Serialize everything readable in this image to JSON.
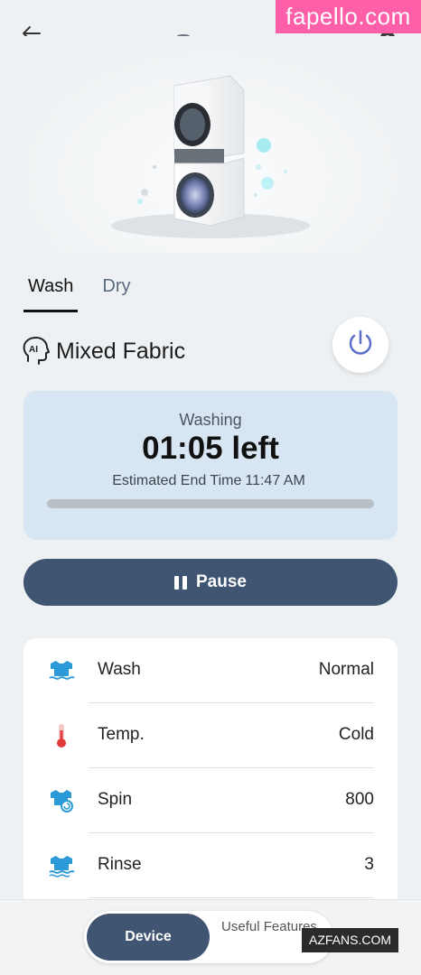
{
  "header": {
    "back_icon": "back-arrow-icon",
    "settings_icon": "gear-icon"
  },
  "watermarks": {
    "top": "fapello.com",
    "bottom": "AZFANS.COM"
  },
  "hero": {
    "image": "stacked-washer-dryer"
  },
  "tabs": [
    {
      "label": "Wash",
      "active": true
    },
    {
      "label": "Dry",
      "active": false
    }
  ],
  "program": {
    "icon": "ai-head-icon",
    "name": "Mixed Fabric"
  },
  "power_icon": "power-icon",
  "status": {
    "label": "Washing",
    "remaining": "01:05 left",
    "end_time_label": "Estimated End Time",
    "end_time_value": "11:47 AM",
    "progress": 0
  },
  "controls": {
    "pause_label": "Pause",
    "pause_icon": "pause-icon"
  },
  "settings": [
    {
      "icon": "wash-shirt-icon",
      "label": "Wash",
      "value": "Normal"
    },
    {
      "icon": "thermometer-icon",
      "label": "Temp.",
      "value": "Cold"
    },
    {
      "icon": "spin-shirt-icon",
      "label": "Spin",
      "value": "800"
    },
    {
      "icon": "rinse-shirt-icon",
      "label": "Rinse",
      "value": "3"
    }
  ],
  "bottom_nav": {
    "device_label": "Device",
    "features_label": "Useful Features"
  },
  "colors": {
    "accent": "#3f5571",
    "status_card": "#d7e6f2",
    "background": "#eef1f3",
    "icon_blue": "#2b9ad6",
    "power_ring": "#5b6fc9"
  }
}
